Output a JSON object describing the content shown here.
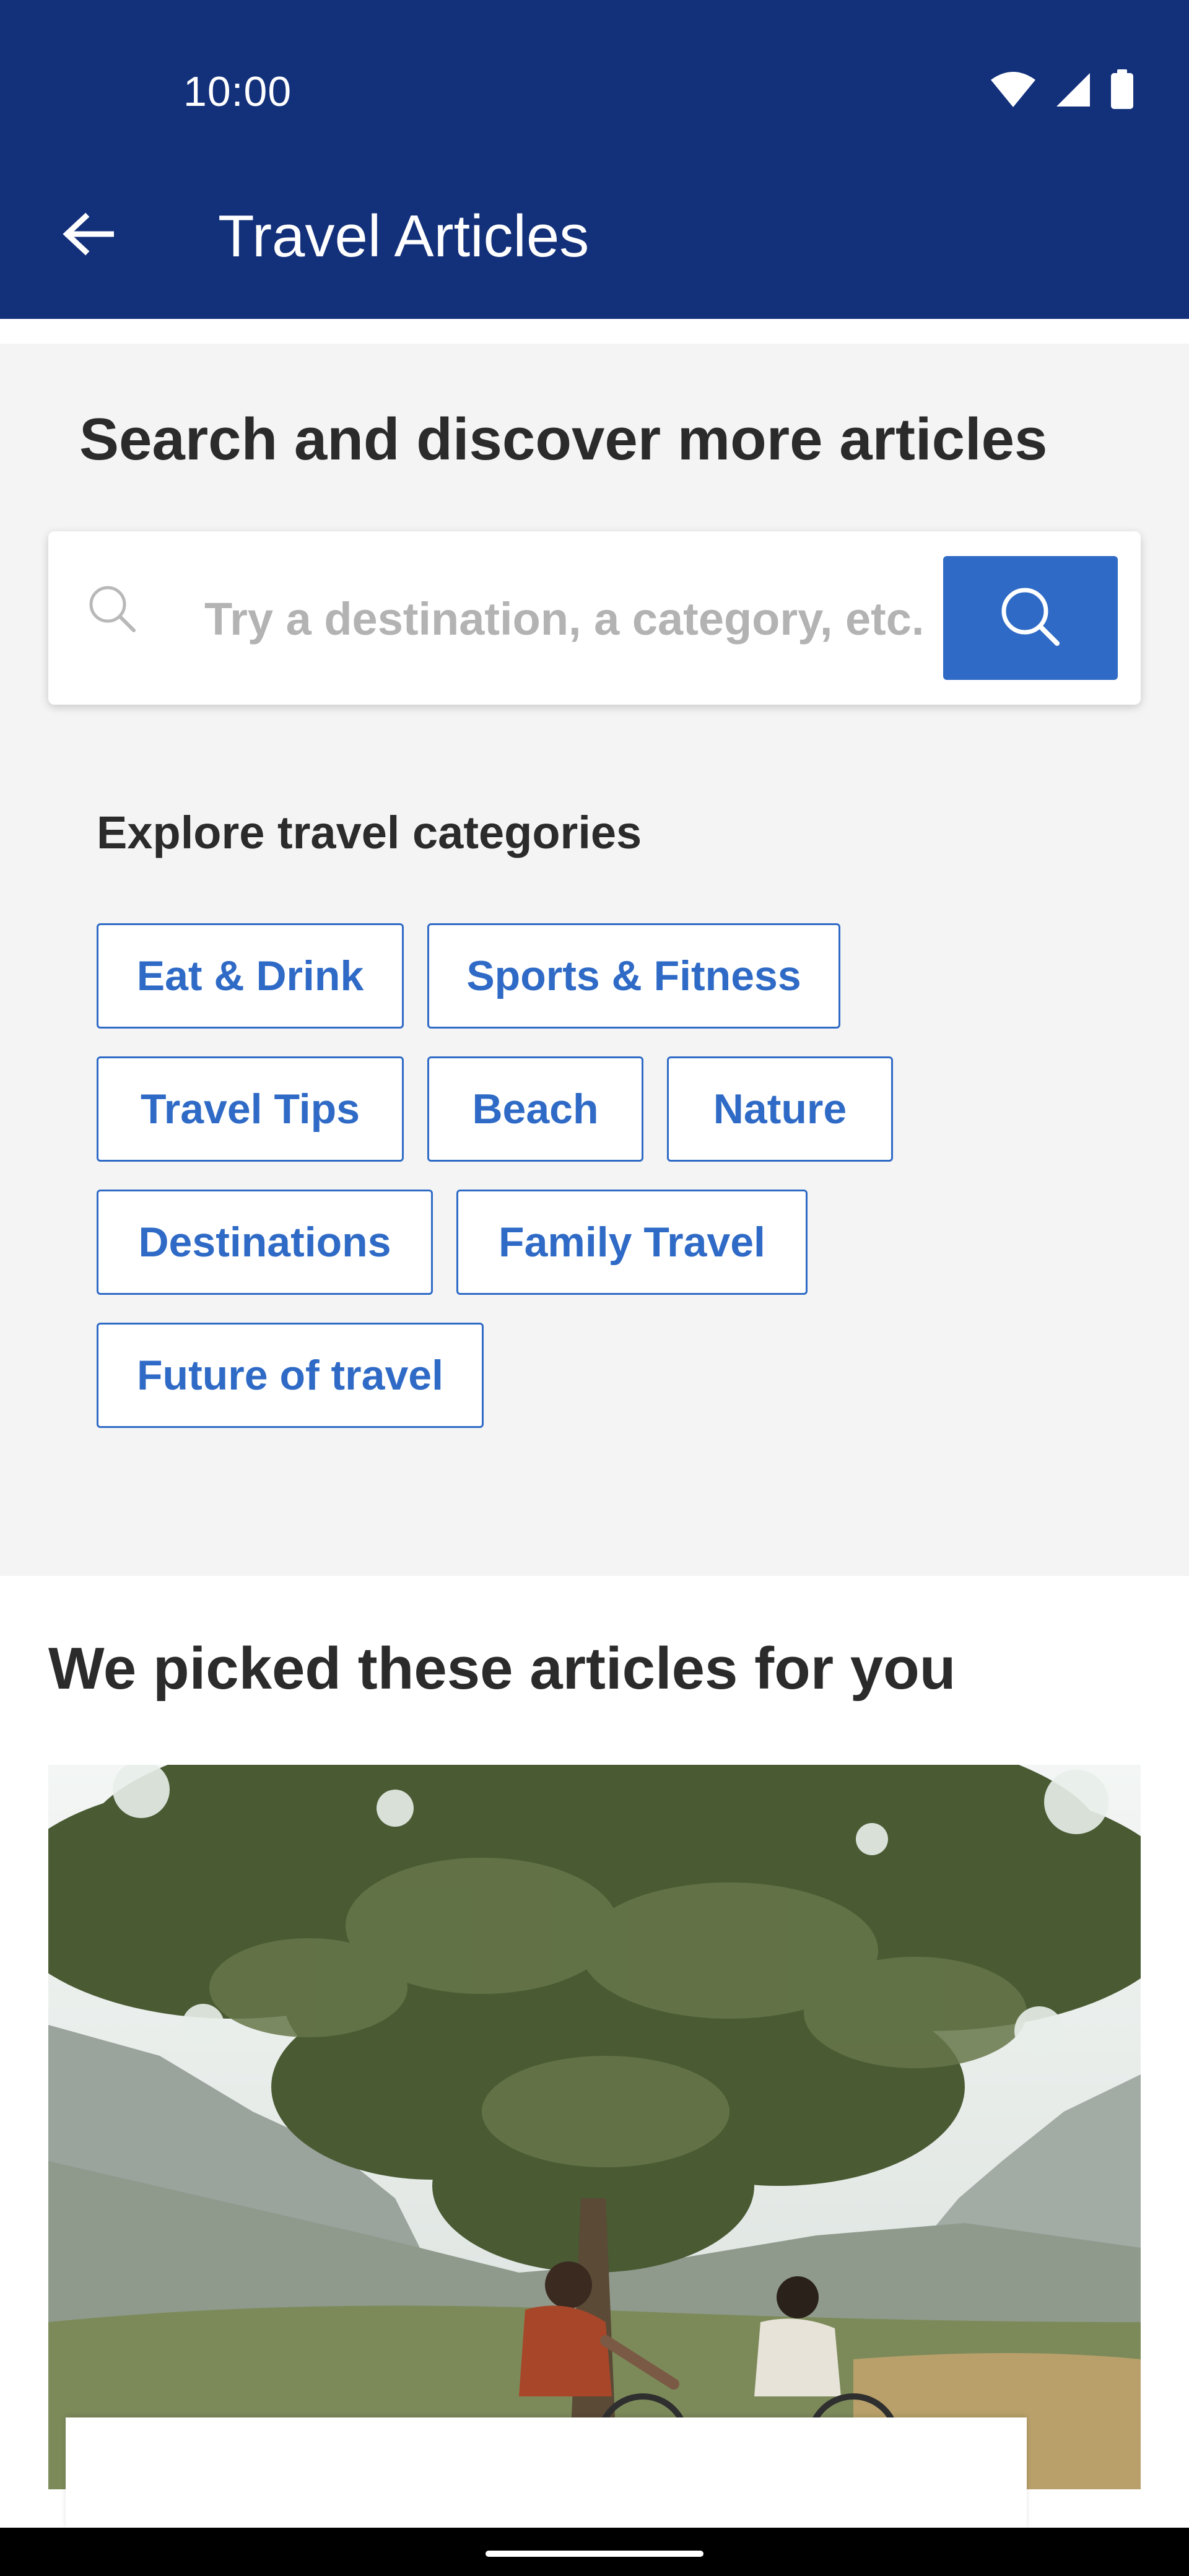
{
  "status_bar": {
    "time": "10:00",
    "icons": [
      "wifi-icon",
      "cell-signal-icon",
      "battery-icon"
    ]
  },
  "app_bar": {
    "title": "Travel Articles",
    "back_icon": "arrow-left-icon"
  },
  "search": {
    "heading": "Search and discover more articles",
    "placeholder": "Try a destination, a category, etc.",
    "value": "",
    "leading_icon": "search-icon",
    "button_icon": "search-icon"
  },
  "categories": {
    "heading": "Explore travel categories",
    "items": [
      "Eat & Drink",
      "Sports & Fitness",
      "Travel Tips",
      "Beach",
      "Nature",
      "Destinations",
      "Family Travel",
      "Future of travel"
    ]
  },
  "picked": {
    "heading": "We picked these articles for you"
  },
  "colors": {
    "app_bar": "#13307a",
    "accent": "#2f6bc6",
    "section_bg": "#f4f4f4",
    "text": "#2b2b2b"
  }
}
